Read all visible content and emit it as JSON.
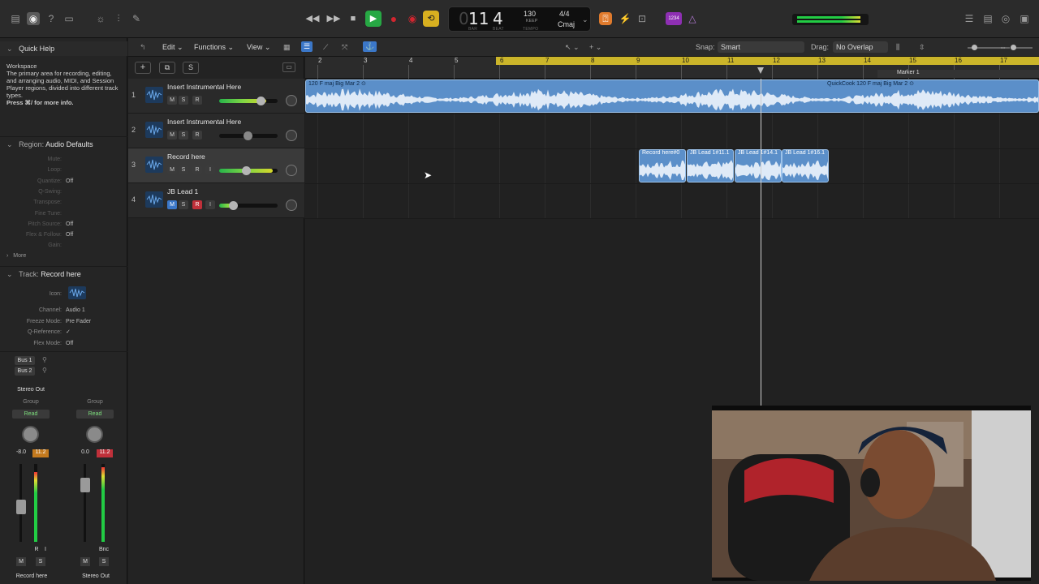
{
  "transport": {
    "bar": "11",
    "beat": "4",
    "bar_label": "BAR",
    "beat_label": "BEAT",
    "tempo": "130",
    "tempo_mode": "KEEP",
    "tempo_label": "TEMPO",
    "signature": "4/4",
    "key": "Cmaj",
    "badge": "1234"
  },
  "inspector": {
    "quick_help_title": "Quick Help",
    "quick_help_heading": "Workspace",
    "quick_help_body": "The primary area for recording, editing, and arranging audio, MIDI, and Session Player regions, divided into different track types.",
    "quick_help_link": "Press ⌘/ for more info.",
    "region_label": "Region:",
    "region_value": "Audio Defaults",
    "region_rows": [
      {
        "k": "Mute:",
        "v": ""
      },
      {
        "k": "Loop:",
        "v": ""
      },
      {
        "k": "Quantize:",
        "v": "Off"
      },
      {
        "k": "Q-Swing:",
        "v": ""
      },
      {
        "k": "Transpose:",
        "v": ""
      },
      {
        "k": "Fine Tune:",
        "v": ""
      },
      {
        "k": "Pitch Source:",
        "v": "Off"
      },
      {
        "k": "Flex & Follow:",
        "v": "Off"
      },
      {
        "k": "Gain:",
        "v": ""
      }
    ],
    "more_label": "More",
    "track_label": "Track:",
    "track_value": "Record here",
    "track_rows": [
      {
        "k": "Icon:",
        "v": ""
      },
      {
        "k": "Channel:",
        "v": "Audio 1"
      },
      {
        "k": "Freeze Mode:",
        "v": "Pre Fader"
      },
      {
        "k": "Q-Reference:",
        "v": "✓"
      },
      {
        "k": "Flex Mode:",
        "v": "Off"
      }
    ],
    "strips": [
      {
        "bus1": "Bus 1",
        "bus2": "Bus 2",
        "output": "Stereo Out",
        "group": "Group",
        "automation": "Read",
        "vol": "-8.0",
        "peak": "11.2",
        "name": "Record here",
        "m": "M",
        "s": "S",
        "r": "R",
        "i": "I"
      },
      {
        "output": "",
        "group": "Group",
        "automation": "Read",
        "vol": "0.0",
        "peak": "11.2",
        "name": "Stereo Out",
        "m": "M",
        "s": "S",
        "bnc": "Bnc"
      }
    ]
  },
  "toolbar": {
    "edit": "Edit",
    "functions": "Functions",
    "view": "View",
    "snap_label": "Snap:",
    "snap_value": "Smart",
    "drag_label": "Drag:",
    "drag_value": "No Overlap",
    "add_track": "+",
    "s_button": "S"
  },
  "ruler": {
    "bars": [
      "2",
      "3",
      "4",
      "5",
      "6",
      "7",
      "8",
      "9",
      "10",
      "11",
      "12",
      "13",
      "14",
      "15",
      "16",
      "17"
    ],
    "marker": "Marker 1"
  },
  "tracks": [
    {
      "num": "1",
      "name": "Insert Instrumental Here",
      "m": "M",
      "s": "S",
      "r": "R"
    },
    {
      "num": "2",
      "name": "Insert Instrumental Here",
      "m": "M",
      "s": "S",
      "r": "R"
    },
    {
      "num": "3",
      "name": "Record here",
      "m": "M",
      "s": "S",
      "r": "R",
      "i": "I"
    },
    {
      "num": "4",
      "name": "JB Lead 1",
      "m": "M",
      "s": "S",
      "r": "R",
      "i": "I"
    }
  ],
  "regions": [
    {
      "label": "120 F maj Big Mar 2 ⊙"
    },
    {
      "label": "QuickCook 120 F maj Big Mar 2 ⊙"
    },
    {
      "label": "Record here#0"
    },
    {
      "label": "JB Lead 1#11.1"
    },
    {
      "label": "JB Lead 1#14.1"
    },
    {
      "label": "JB Lead 1#16.1"
    }
  ],
  "colors": {
    "accent_blue": "#3b77c8",
    "play_green": "#27a844",
    "record_red": "#d2252f",
    "cycle_yellow": "#d8b020",
    "ruler_cycle": "#cbb52a",
    "region_blue": "#5b8fc9"
  },
  "icons": [
    "library-icon",
    "inspector-icon",
    "quick-help-icon",
    "toolbar-icon",
    "smart-controls-icon",
    "mixer-icon",
    "editors-icon",
    "rewind-icon",
    "forward-icon",
    "stop-icon",
    "play-icon",
    "record-icon",
    "capture-icon",
    "cycle-icon",
    "tuner-icon",
    "metronome-icon",
    "list-icon",
    "notes-icon",
    "loops-icon",
    "browser-icon"
  ]
}
